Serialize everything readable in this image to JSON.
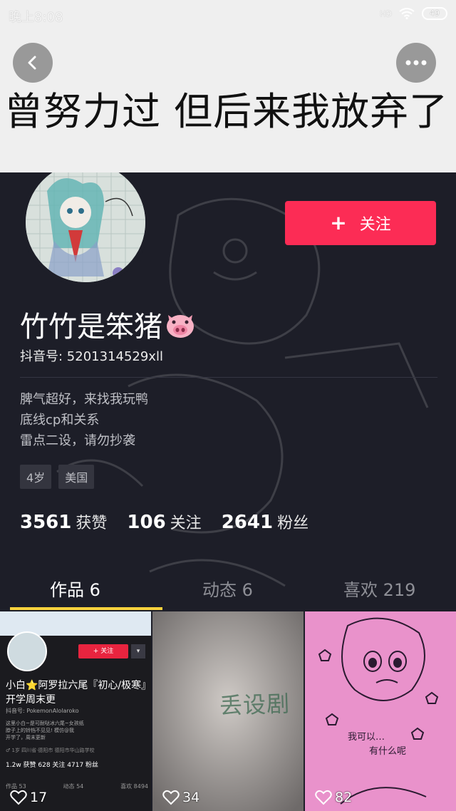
{
  "status_bar": {
    "time": "晚上8:08",
    "signal": "HD",
    "battery": "49"
  },
  "banner": {
    "text": "曾努力过 但后来我放弃了"
  },
  "profile": {
    "follow_label": "关注",
    "nickname": "竹竹是笨猪",
    "douyin_id": "抖音号: 5201314529xll",
    "bio": [
      "脾气超好，来找我玩鸭",
      "底线cp和关系",
      "雷点二设，请勿抄袭"
    ],
    "tags": [
      "4岁",
      "美国"
    ],
    "stats": [
      {
        "value": "3561",
        "label": "获赞"
      },
      {
        "value": "106",
        "label": "关注"
      },
      {
        "value": "2641",
        "label": "粉丝"
      }
    ]
  },
  "tabs": [
    {
      "label": "作品 6",
      "active": true
    },
    {
      "label": "动态 6",
      "active": false
    },
    {
      "label": "喜欢 219",
      "active": false
    }
  ],
  "works": [
    {
      "likes": "17"
    },
    {
      "likes": "34"
    },
    {
      "likes": "82"
    }
  ],
  "thumb1": {
    "follow": "+ 关注",
    "name": "小白⭐阿罗拉六尾『初心/极寒』开学周末更",
    "id": "抖音号: PokemonAlolaroko",
    "bio": [
      "这里小白~是可耐哒冰六尾~女孩纸",
      "脖子上的铃铛不见见! 模仿@我",
      "开学了，周末更新"
    ],
    "tags": "♂ 1岁   四川省·德阳市   德阳市华山路学校",
    "stats": "1.2w 获赞    628 关注    4717 粉丝",
    "tabs": [
      "作品 53",
      "动态 54",
      "喜欢 8494"
    ]
  },
  "thumb2": {
    "text": "丢设剧"
  },
  "icons": {
    "back": "chevron-left-icon",
    "more": "more-dots-icon",
    "like": "heart-outline-icon"
  },
  "colors": {
    "accent": "#fc2c55",
    "tab_indicator": "#f9d23c",
    "background": "#1d1e28"
  }
}
